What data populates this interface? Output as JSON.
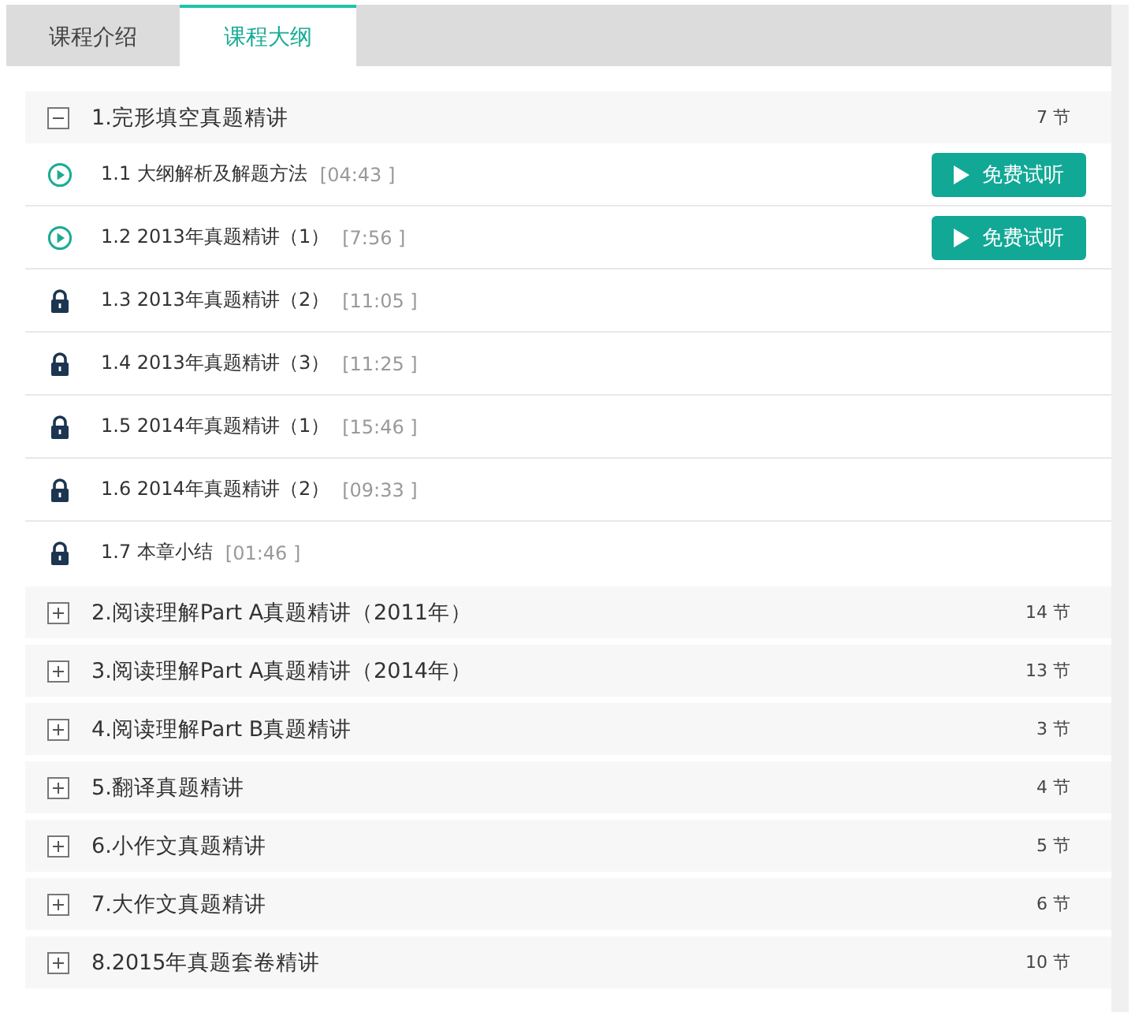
{
  "tabs": [
    {
      "label": "课程介绍",
      "selected": false
    },
    {
      "label": "课程大纲",
      "selected": true
    }
  ],
  "chapters": [
    {
      "title": "1.完形填空真题精讲",
      "count": "7 节",
      "expanded": true,
      "lessons": [
        {
          "kind": "play",
          "title": "1.1 大纲解析及解题方法",
          "duration": "[04:43 ]",
          "button": "免费试听"
        },
        {
          "kind": "play",
          "title": "1.2 2013年真题精讲（1）",
          "duration": "[7:56 ]",
          "button": "免费试听"
        },
        {
          "kind": "lock",
          "title": "1.3 2013年真题精讲（2）",
          "duration": "[11:05 ]"
        },
        {
          "kind": "lock",
          "title": "1.4 2013年真题精讲（3）",
          "duration": "[11:25 ]"
        },
        {
          "kind": "lock",
          "title": "1.5 2014年真题精讲（1）",
          "duration": "[15:46 ]"
        },
        {
          "kind": "lock",
          "title": "1.6 2014年真题精讲（2）",
          "duration": "[09:33 ]"
        },
        {
          "kind": "lock",
          "title": "1.7 本章小结",
          "duration": "[01:46 ]"
        }
      ]
    },
    {
      "title": "2.阅读理解Part A真题精讲（2011年）",
      "count": "14 节",
      "expanded": false
    },
    {
      "title": "3.阅读理解Part A真题精讲（2014年）",
      "count": "13 节",
      "expanded": false
    },
    {
      "title": "4.阅读理解Part B真题精讲",
      "count": "3 节",
      "expanded": false
    },
    {
      "title": "5.翻译真题精讲",
      "count": "4 节",
      "expanded": false
    },
    {
      "title": "6.小作文真题精讲",
      "count": "5 节",
      "expanded": false
    },
    {
      "title": "7.大作文真题精讲",
      "count": "6 节",
      "expanded": false
    },
    {
      "title": "8.2015年真题套卷精讲",
      "count": "10 节",
      "expanded": false
    }
  ]
}
